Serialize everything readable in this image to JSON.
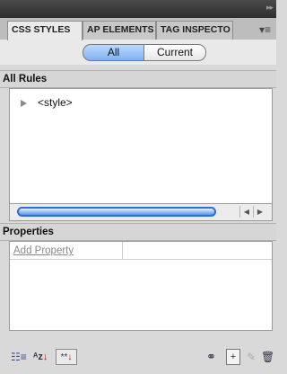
{
  "tabs": [
    {
      "label": "CSS STYLES",
      "active": true
    },
    {
      "label": "AP ELEMENTS",
      "active": false
    },
    {
      "label": "TAG INSPECTO",
      "active": false
    }
  ],
  "panel_menu_icon": "panel-menu-icon",
  "scope": {
    "all_label": "All",
    "current_label": "Current",
    "selected": "All"
  },
  "rules": {
    "header": "All Rules",
    "items": [
      {
        "label": "<style>"
      }
    ]
  },
  "properties": {
    "header": "Properties",
    "add_property_label": "Add Property"
  },
  "toolbar": {
    "icons": [
      "show-category-view-icon",
      "show-alphabetical-view-icon",
      "show-set-properties-icon",
      "attach-style-sheet-icon",
      "new-css-rule-icon",
      "edit-rule-icon",
      "delete-rule-icon"
    ]
  },
  "colors": {
    "selected_segment": "#7fb2f2",
    "scroll_thumb": "#2f6fd3"
  }
}
